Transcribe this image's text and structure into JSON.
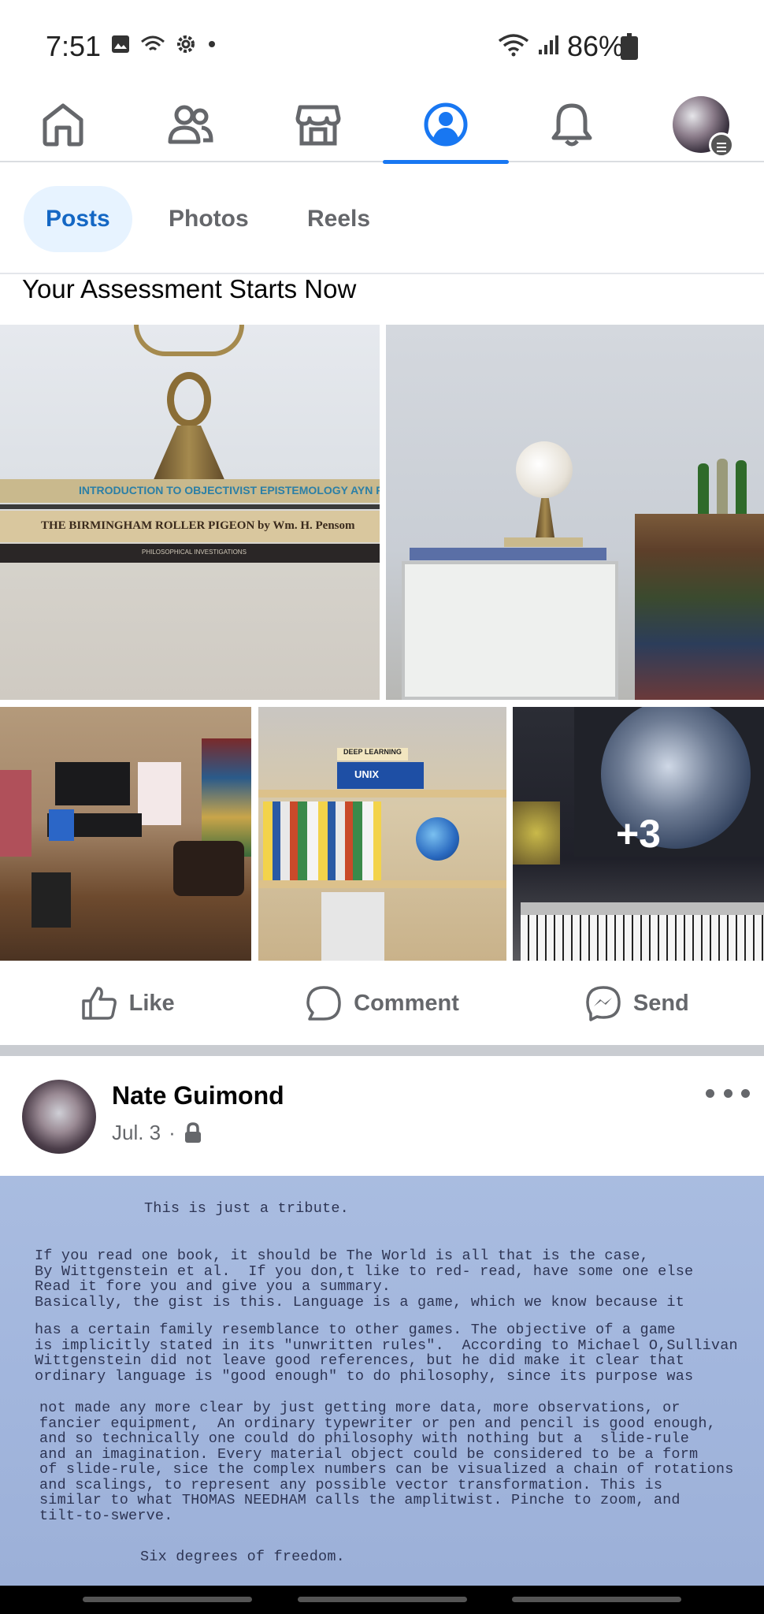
{
  "status_bar": {
    "time": "7:51",
    "battery_percent": "86%",
    "icons": [
      "image-icon",
      "hotspot-icon",
      "settings-icon",
      "dot-icon",
      "wifi-icon",
      "signal-icon",
      "battery-icon"
    ]
  },
  "top_nav": {
    "items": [
      "home-icon",
      "friends-icon",
      "marketplace-icon",
      "profile-icon",
      "notifications-icon",
      "menu-avatar"
    ],
    "active": "profile-icon",
    "accent_color": "#1877f2"
  },
  "tabs": {
    "items": [
      {
        "label": "Posts",
        "active": true
      },
      {
        "label": "Photos",
        "active": false
      },
      {
        "label": "Reels",
        "active": false
      }
    ]
  },
  "post1": {
    "title": "Your Assessment Starts Now",
    "photos": [
      {
        "name": "books-globe-base-photo",
        "books": [
          "INTRODUCTION TO OBJECTIVIST EPISTEMOLOGY   AYN RAND",
          "THE BIRMINGHAM ROLLER PIGEON   by Wm. H. Pensom",
          "PHILOSOPHICAL INVESTIGATIONS"
        ]
      },
      {
        "name": "globe-whiteboard-photo"
      },
      {
        "name": "office-room-photo"
      },
      {
        "name": "bookshelf-photo",
        "books": [
          "DEEP LEARNING",
          "UNIX"
        ]
      },
      {
        "name": "moon-painting-keyboard-photo",
        "overlay": "+3"
      }
    ],
    "actions": {
      "like": "Like",
      "comment": "Comment",
      "send": "Send"
    }
  },
  "post2": {
    "author": "Nate Guimond",
    "date": "Jul. 3",
    "separator": "·",
    "privacy_icon": "lock-icon",
    "letter": {
      "heading": "This is just a tribute.",
      "para1": "If you read one book, it should be The World is all that is the case,\nBy Wittgenstein et al.  If you don,t like to red- read, have some one else\nRead it fore you and give you a summary.\nBasically, the gist is this. Language is a game, which we know because it",
      "para2": "has a certain family resemblance to other games. The objective of a game\nis implicitly stated in its \"unwritten rules\".  According to Michael O,Sullivan\nWittgenstein did not leave good references, but he did make it clear that\nordinary language is \"good enough\" to do philosophy, since its purpose was",
      "para3": "not made any more clear by just getting more data, more observations, or\nfancier equipment,  An ordinary typewriter or pen and pencil is good enough,\nand so technically one could do philosophy with nothing but a  slide-rule\nand an imagination. Every material object could be considered to be a form\nof slide-rule, sice the complex numbers can be visualized a chain of rotations\nand scalings, to represent any possible vector transformation. This is\nsimilar to what THOMAS NEEDHAM calls the amplitwist. Pinche to zoom, and\ntilt-to-swerve.",
      "closing": "Six degrees of freedom."
    }
  }
}
